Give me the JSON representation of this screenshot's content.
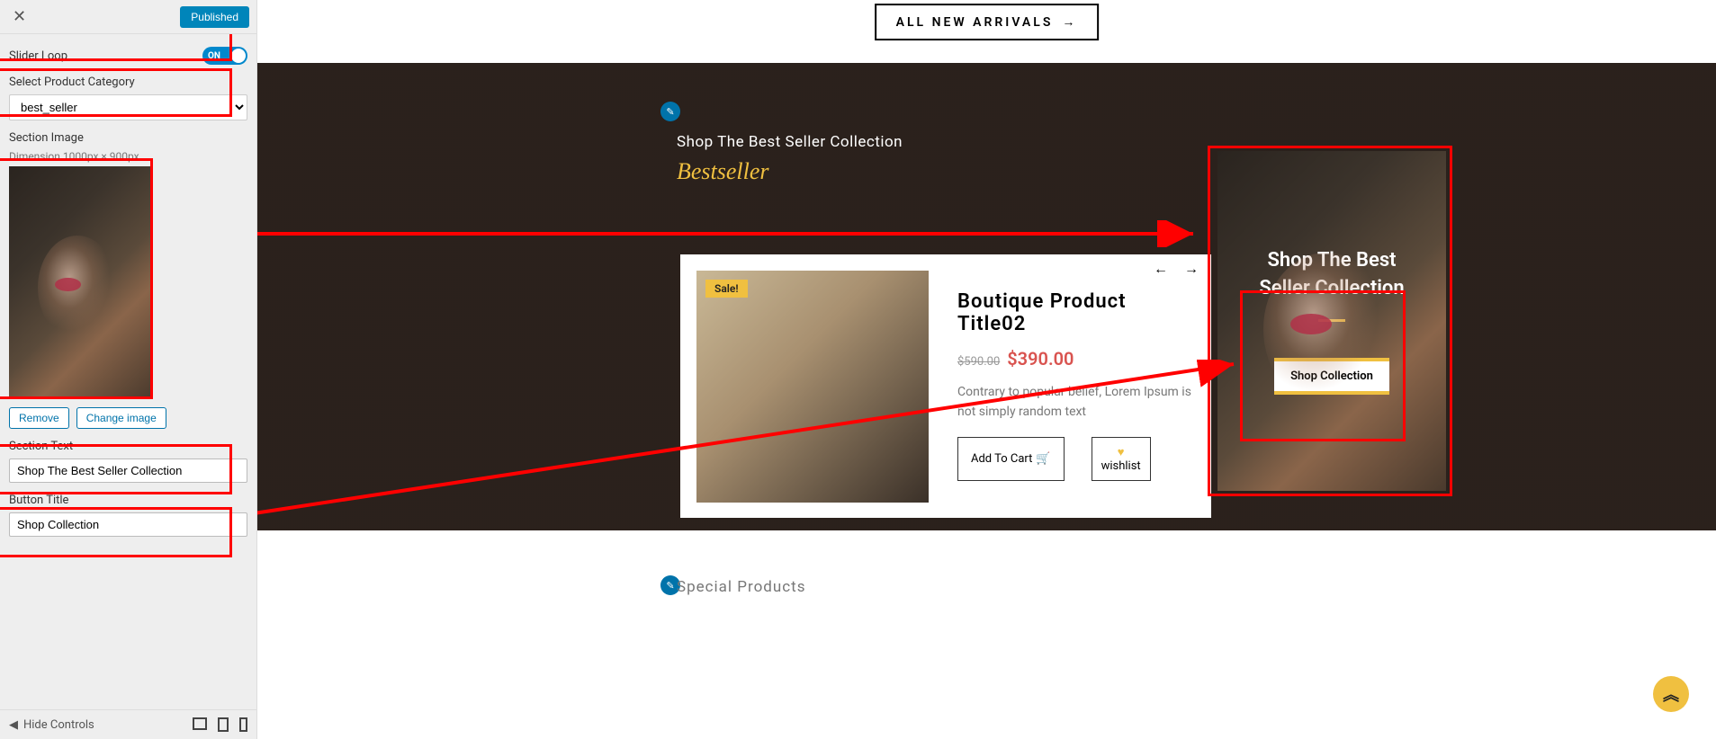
{
  "sidebar": {
    "publish_label": "Published",
    "slider_loop_label": "Slider Loop",
    "slider_loop_value": "ON",
    "category_label": "Select Product Category",
    "category_value": "best_seller",
    "section_image_label": "Section Image",
    "dimensions": "Dimension 1000px × 900px",
    "remove_label": "Remove",
    "change_image_label": "Change image",
    "section_text_label": "Section Text",
    "section_text_value": "Shop The Best Seller Collection",
    "button_title_label": "Button Title",
    "button_title_value": "Shop Collection",
    "hide_controls_label": "Hide Controls"
  },
  "preview": {
    "new_arrivals": "ALL NEW ARRIVALS",
    "hero_sub": "Shop The Best Seller Collection",
    "hero_title": "Bestseller",
    "product": {
      "sale": "Sale!",
      "title": "Boutique Product Title02",
      "old_price": "$590.00",
      "new_price": "$390.00",
      "desc": "Contrary to popular belief, Lorem Ipsum is not simply random text",
      "add_cart": "Add To Cart",
      "wishlist": "wishlist"
    },
    "promo": {
      "title_line1": "Shop The Best",
      "title_line2": "Seller Collection",
      "button": "Shop Collection"
    },
    "special": "Special Products"
  }
}
